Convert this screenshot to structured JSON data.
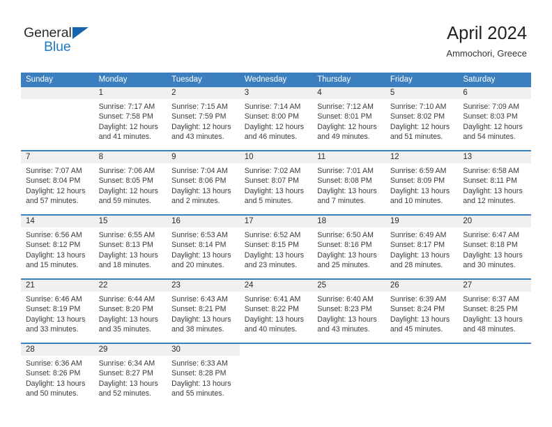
{
  "brand": {
    "name_top": "General",
    "name_bottom": "Blue",
    "triangle_color": "#1665b0",
    "blue_color": "#2079c4"
  },
  "header": {
    "title": "April 2024",
    "location": "Ammochori, Greece",
    "header_bg": "#3b7fbf",
    "daynum_band_bg": "#f0f0f0"
  },
  "weekday_headers": [
    "Sunday",
    "Monday",
    "Tuesday",
    "Wednesday",
    "Thursday",
    "Friday",
    "Saturday"
  ],
  "weeks": [
    {
      "days": [
        {
          "num": "",
          "sunrise": "",
          "sunset": "",
          "daylight1": "",
          "daylight2": "",
          "empty": true
        },
        {
          "num": "1",
          "sunrise": "Sunrise: 7:17 AM",
          "sunset": "Sunset: 7:58 PM",
          "daylight1": "Daylight: 12 hours",
          "daylight2": "and 41 minutes."
        },
        {
          "num": "2",
          "sunrise": "Sunrise: 7:15 AM",
          "sunset": "Sunset: 7:59 PM",
          "daylight1": "Daylight: 12 hours",
          "daylight2": "and 43 minutes."
        },
        {
          "num": "3",
          "sunrise": "Sunrise: 7:14 AM",
          "sunset": "Sunset: 8:00 PM",
          "daylight1": "Daylight: 12 hours",
          "daylight2": "and 46 minutes."
        },
        {
          "num": "4",
          "sunrise": "Sunrise: 7:12 AM",
          "sunset": "Sunset: 8:01 PM",
          "daylight1": "Daylight: 12 hours",
          "daylight2": "and 49 minutes."
        },
        {
          "num": "5",
          "sunrise": "Sunrise: 7:10 AM",
          "sunset": "Sunset: 8:02 PM",
          "daylight1": "Daylight: 12 hours",
          "daylight2": "and 51 minutes."
        },
        {
          "num": "6",
          "sunrise": "Sunrise: 7:09 AM",
          "sunset": "Sunset: 8:03 PM",
          "daylight1": "Daylight: 12 hours",
          "daylight2": "and 54 minutes."
        }
      ]
    },
    {
      "days": [
        {
          "num": "7",
          "sunrise": "Sunrise: 7:07 AM",
          "sunset": "Sunset: 8:04 PM",
          "daylight1": "Daylight: 12 hours",
          "daylight2": "and 57 minutes."
        },
        {
          "num": "8",
          "sunrise": "Sunrise: 7:06 AM",
          "sunset": "Sunset: 8:05 PM",
          "daylight1": "Daylight: 12 hours",
          "daylight2": "and 59 minutes."
        },
        {
          "num": "9",
          "sunrise": "Sunrise: 7:04 AM",
          "sunset": "Sunset: 8:06 PM",
          "daylight1": "Daylight: 13 hours",
          "daylight2": "and 2 minutes."
        },
        {
          "num": "10",
          "sunrise": "Sunrise: 7:02 AM",
          "sunset": "Sunset: 8:07 PM",
          "daylight1": "Daylight: 13 hours",
          "daylight2": "and 5 minutes."
        },
        {
          "num": "11",
          "sunrise": "Sunrise: 7:01 AM",
          "sunset": "Sunset: 8:08 PM",
          "daylight1": "Daylight: 13 hours",
          "daylight2": "and 7 minutes."
        },
        {
          "num": "12",
          "sunrise": "Sunrise: 6:59 AM",
          "sunset": "Sunset: 8:09 PM",
          "daylight1": "Daylight: 13 hours",
          "daylight2": "and 10 minutes."
        },
        {
          "num": "13",
          "sunrise": "Sunrise: 6:58 AM",
          "sunset": "Sunset: 8:11 PM",
          "daylight1": "Daylight: 13 hours",
          "daylight2": "and 12 minutes."
        }
      ]
    },
    {
      "days": [
        {
          "num": "14",
          "sunrise": "Sunrise: 6:56 AM",
          "sunset": "Sunset: 8:12 PM",
          "daylight1": "Daylight: 13 hours",
          "daylight2": "and 15 minutes."
        },
        {
          "num": "15",
          "sunrise": "Sunrise: 6:55 AM",
          "sunset": "Sunset: 8:13 PM",
          "daylight1": "Daylight: 13 hours",
          "daylight2": "and 18 minutes."
        },
        {
          "num": "16",
          "sunrise": "Sunrise: 6:53 AM",
          "sunset": "Sunset: 8:14 PM",
          "daylight1": "Daylight: 13 hours",
          "daylight2": "and 20 minutes."
        },
        {
          "num": "17",
          "sunrise": "Sunrise: 6:52 AM",
          "sunset": "Sunset: 8:15 PM",
          "daylight1": "Daylight: 13 hours",
          "daylight2": "and 23 minutes."
        },
        {
          "num": "18",
          "sunrise": "Sunrise: 6:50 AM",
          "sunset": "Sunset: 8:16 PM",
          "daylight1": "Daylight: 13 hours",
          "daylight2": "and 25 minutes."
        },
        {
          "num": "19",
          "sunrise": "Sunrise: 6:49 AM",
          "sunset": "Sunset: 8:17 PM",
          "daylight1": "Daylight: 13 hours",
          "daylight2": "and 28 minutes."
        },
        {
          "num": "20",
          "sunrise": "Sunrise: 6:47 AM",
          "sunset": "Sunset: 8:18 PM",
          "daylight1": "Daylight: 13 hours",
          "daylight2": "and 30 minutes."
        }
      ]
    },
    {
      "days": [
        {
          "num": "21",
          "sunrise": "Sunrise: 6:46 AM",
          "sunset": "Sunset: 8:19 PM",
          "daylight1": "Daylight: 13 hours",
          "daylight2": "and 33 minutes."
        },
        {
          "num": "22",
          "sunrise": "Sunrise: 6:44 AM",
          "sunset": "Sunset: 8:20 PM",
          "daylight1": "Daylight: 13 hours",
          "daylight2": "and 35 minutes."
        },
        {
          "num": "23",
          "sunrise": "Sunrise: 6:43 AM",
          "sunset": "Sunset: 8:21 PM",
          "daylight1": "Daylight: 13 hours",
          "daylight2": "and 38 minutes."
        },
        {
          "num": "24",
          "sunrise": "Sunrise: 6:41 AM",
          "sunset": "Sunset: 8:22 PM",
          "daylight1": "Daylight: 13 hours",
          "daylight2": "and 40 minutes."
        },
        {
          "num": "25",
          "sunrise": "Sunrise: 6:40 AM",
          "sunset": "Sunset: 8:23 PM",
          "daylight1": "Daylight: 13 hours",
          "daylight2": "and 43 minutes."
        },
        {
          "num": "26",
          "sunrise": "Sunrise: 6:39 AM",
          "sunset": "Sunset: 8:24 PM",
          "daylight1": "Daylight: 13 hours",
          "daylight2": "and 45 minutes."
        },
        {
          "num": "27",
          "sunrise": "Sunrise: 6:37 AM",
          "sunset": "Sunset: 8:25 PM",
          "daylight1": "Daylight: 13 hours",
          "daylight2": "and 48 minutes."
        }
      ]
    },
    {
      "days": [
        {
          "num": "28",
          "sunrise": "Sunrise: 6:36 AM",
          "sunset": "Sunset: 8:26 PM",
          "daylight1": "Daylight: 13 hours",
          "daylight2": "and 50 minutes."
        },
        {
          "num": "29",
          "sunrise": "Sunrise: 6:34 AM",
          "sunset": "Sunset: 8:27 PM",
          "daylight1": "Daylight: 13 hours",
          "daylight2": "and 52 minutes."
        },
        {
          "num": "30",
          "sunrise": "Sunrise: 6:33 AM",
          "sunset": "Sunset: 8:28 PM",
          "daylight1": "Daylight: 13 hours",
          "daylight2": "and 55 minutes."
        },
        {
          "num": "",
          "sunrise": "",
          "sunset": "",
          "daylight1": "",
          "daylight2": "",
          "blank": true
        },
        {
          "num": "",
          "sunrise": "",
          "sunset": "",
          "daylight1": "",
          "daylight2": "",
          "blank": true
        },
        {
          "num": "",
          "sunrise": "",
          "sunset": "",
          "daylight1": "",
          "daylight2": "",
          "blank": true
        },
        {
          "num": "",
          "sunrise": "",
          "sunset": "",
          "daylight1": "",
          "daylight2": "",
          "blank": true
        }
      ]
    }
  ]
}
